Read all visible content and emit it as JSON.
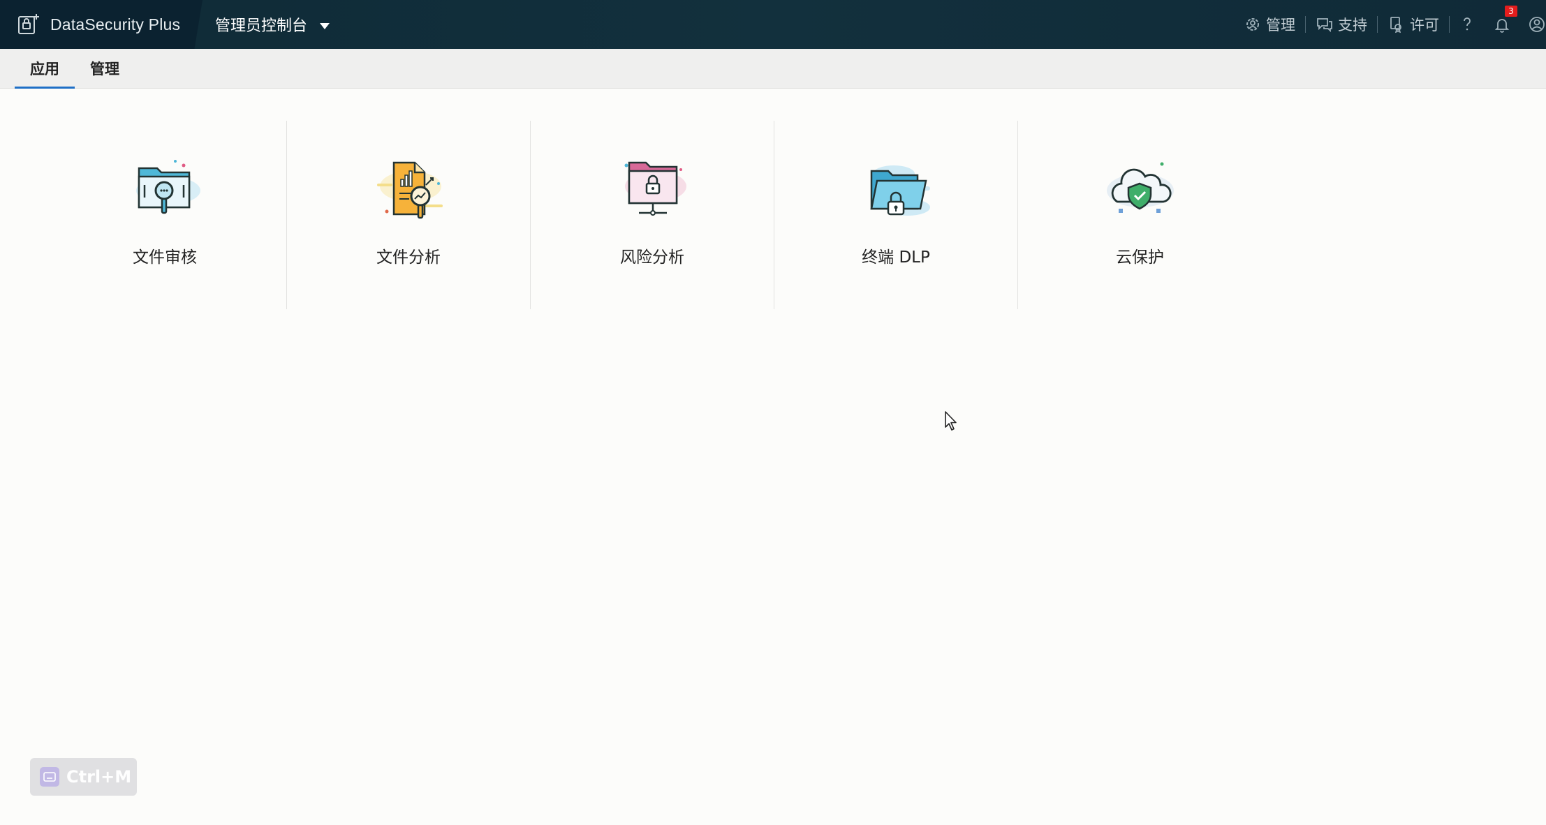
{
  "header": {
    "brand": "DataSecurity Plus",
    "console": "管理员控制台",
    "links": [
      {
        "label": "管理",
        "icon": "gear-user-icon"
      },
      {
        "label": "支持",
        "icon": "chat-icon"
      },
      {
        "label": "许可",
        "icon": "license-icon"
      }
    ],
    "help_icon": "question-icon",
    "notifications": {
      "icon": "bell-icon",
      "count": "3"
    },
    "user_icon": "user-icon"
  },
  "tabs": [
    {
      "label": "应用",
      "active": true
    },
    {
      "label": "管理",
      "active": false
    }
  ],
  "apps": [
    {
      "label": "文件审核",
      "icon": "file-audit-icon"
    },
    {
      "label": "文件分析",
      "icon": "file-analysis-icon"
    },
    {
      "label": "风险分析",
      "icon": "risk-analysis-icon"
    },
    {
      "label": "终端 DLP",
      "icon": "endpoint-dlp-icon"
    },
    {
      "label": "云保护",
      "icon": "cloud-protection-icon"
    }
  ],
  "shortcut": {
    "label": "Ctrl+M"
  },
  "colors": {
    "topbar": "#12303d",
    "tab_active": "#1f6fc6",
    "badge": "#e41d1d"
  }
}
